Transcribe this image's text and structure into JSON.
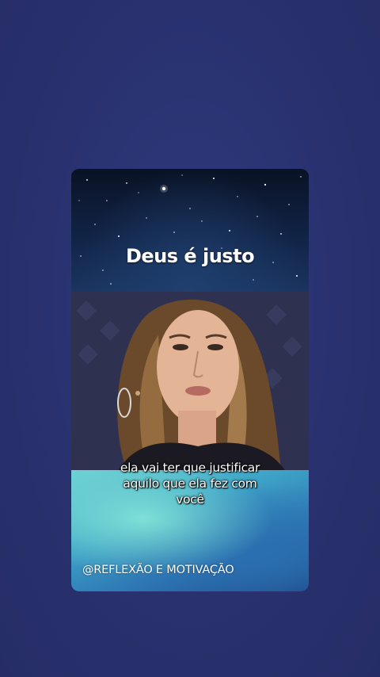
{
  "video": {
    "title": "Deus é justo",
    "caption_lines": [
      "ela vai ter que justificar",
      "aquilo que ela fez com",
      "você"
    ],
    "watermark": "@REFLEXÃO E MOTIVAÇÃO"
  },
  "colors": {
    "page_background": "#2b3370",
    "caption_text": "#ffffff"
  }
}
